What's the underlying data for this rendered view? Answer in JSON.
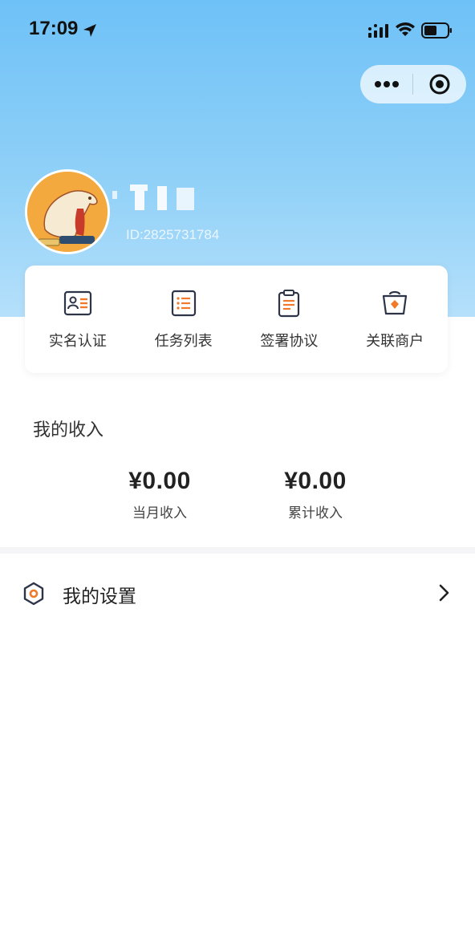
{
  "status_bar": {
    "time": "17:09"
  },
  "capsule": {
    "more_icon": "ellipsis-icon",
    "close_icon": "target-circle-icon"
  },
  "profile": {
    "user_id": "ID:2825731784"
  },
  "quick_actions": [
    {
      "label": "实名认证",
      "icon": "id-card-icon"
    },
    {
      "label": "任务列表",
      "icon": "task-list-icon"
    },
    {
      "label": "签署协议",
      "icon": "clipboard-icon"
    },
    {
      "label": "关联商户",
      "icon": "merchant-bag-icon"
    }
  ],
  "income": {
    "title": "我的收入",
    "monthly": {
      "amount": "¥0.00",
      "label": "当月收入"
    },
    "total": {
      "amount": "¥0.00",
      "label": "累计收入"
    }
  },
  "settings": {
    "label": "我的设置"
  },
  "colors": {
    "accent_orange": "#f07a2a",
    "header_blue": "#6ec1f7",
    "icon_dark": "#2d3447"
  }
}
